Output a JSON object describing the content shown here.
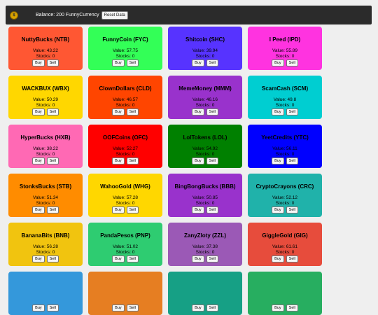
{
  "header": {
    "logo_icon": "coin-icon",
    "balance_text": "Balance: 200 FunnyCurrency",
    "reset_label": "Reset Data"
  },
  "labels": {
    "buy": "Buy",
    "sell": "Sell"
  },
  "currencies": [
    {
      "name": "NuttyBucks (NTB)",
      "value": "Value: 43.22",
      "stocks": "Stocks: 0",
      "color": "#ff5733"
    },
    {
      "name": "FunnyCoin (FYC)",
      "value": "Value: 57.75",
      "stocks": "Stocks: 0",
      "color": "#33ff57"
    },
    {
      "name": "Shitcoin (SHC)",
      "value": "Value: 39.94",
      "stocks": "Stocks: 0",
      "color": "#5733ff"
    },
    {
      "name": "I Peed (IPD)",
      "value": "Value: 55.89",
      "stocks": "Stocks: 0",
      "color": "#ff33e0"
    },
    {
      "name": "WACKBUX (WBX)",
      "value": "Value: 50.29",
      "stocks": "Stocks: 0",
      "color": "#ffd700"
    },
    {
      "name": "ClownDollars (CLD)",
      "value": "Value: 46.57",
      "stocks": "Stocks: 0",
      "color": "#ff4500"
    },
    {
      "name": "MemeMoney (MMM)",
      "value": "Value: 46.16",
      "stocks": "Stocks: 0",
      "color": "#9932cc"
    },
    {
      "name": "ScamCash (SCM)",
      "value": "Value: 49.8",
      "stocks": "Stocks: 0",
      "color": "#00ced1"
    },
    {
      "name": "HyperBucks (HXB)",
      "value": "Value: 38.22",
      "stocks": "Stocks: 0",
      "color": "#ff69b4"
    },
    {
      "name": "OOFCoins (OFC)",
      "value": "Value: 52.27",
      "stocks": "Stocks: 0",
      "color": "#ff0000"
    },
    {
      "name": "LolTokens (LOL)",
      "value": "Value: 54.92",
      "stocks": "Stocks: 0",
      "color": "#008000"
    },
    {
      "name": "YeetCredits (YTC)",
      "value": "Value: 56.11",
      "stocks": "Stocks: 0",
      "color": "#0000ff"
    },
    {
      "name": "StonksBucks (STB)",
      "value": "Value: 51.34",
      "stocks": "Stocks: 0",
      "color": "#ff8c00"
    },
    {
      "name": "WahooGold (WHG)",
      "value": "Value: 57.28",
      "stocks": "Stocks: 0",
      "color": "#ffd700"
    },
    {
      "name": "BingBongBucks (BBB)",
      "value": "Value: 50.85",
      "stocks": "Stocks: 0",
      "color": "#9932cc"
    },
    {
      "name": "CryptoCrayons (CRC)",
      "value": "Value: 52.12",
      "stocks": "Stocks: 0",
      "color": "#20b2aa"
    },
    {
      "name": "BananaBits (BNB)",
      "value": "Value: 56.28",
      "stocks": "Stocks: 0",
      "color": "#f1c40f"
    },
    {
      "name": "PandaPesos (PNP)",
      "value": "Value: 51.02",
      "stocks": "Stocks: 0",
      "color": "#2ecc71"
    },
    {
      "name": "ZanyZloty (ZZL)",
      "value": "Value: 37.38",
      "stocks": "Stocks: 0",
      "color": "#9b59b6"
    },
    {
      "name": "GiggleGold (GIG)",
      "value": "Value: 61.61",
      "stocks": "Stocks: 0",
      "color": "#e74c3c"
    },
    {
      "name": "",
      "value": "",
      "stocks": "",
      "color": "#3498db"
    },
    {
      "name": "",
      "value": "",
      "stocks": "",
      "color": "#e67e22"
    },
    {
      "name": "",
      "value": "",
      "stocks": "",
      "color": "#16a085"
    },
    {
      "name": "",
      "value": "",
      "stocks": "",
      "color": "#27ae60"
    }
  ]
}
